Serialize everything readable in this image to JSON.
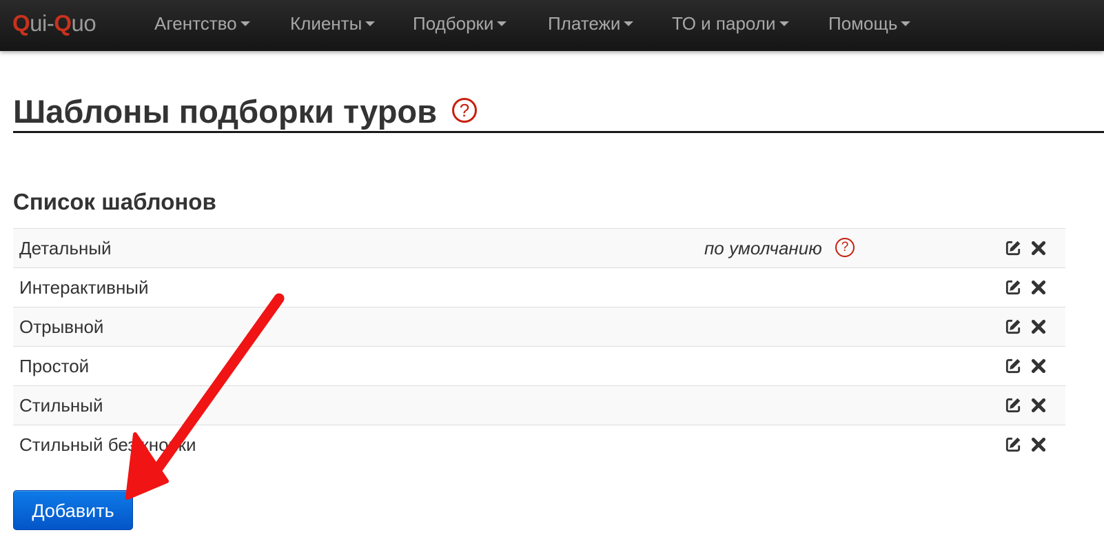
{
  "brand": {
    "q1": "Q",
    "mid": "ui-",
    "q2": "Q",
    "end": "uo"
  },
  "nav": {
    "items": [
      {
        "label": "Агентство"
      },
      {
        "label": "Клиенты"
      },
      {
        "label": "Подборки"
      },
      {
        "label": "Платежи"
      },
      {
        "label": "ТО и пароли"
      },
      {
        "label": "Помощь"
      }
    ]
  },
  "header": {
    "title": "Шаблоны подборки туров",
    "help_symbol": "?"
  },
  "templates": {
    "section_title": "Список шаблонов",
    "default_label": "по умолчанию",
    "help_symbol": "?",
    "rows": [
      {
        "name": "Детальный",
        "is_default": true
      },
      {
        "name": "Интерактивный",
        "is_default": false
      },
      {
        "name": "Отрывной",
        "is_default": false
      },
      {
        "name": "Простой",
        "is_default": false
      },
      {
        "name": "Стильный",
        "is_default": false
      },
      {
        "name": "Стильный без кнопки",
        "is_default": false
      }
    ],
    "row_actions": {
      "edit_icon": "edit-icon",
      "delete_icon": "delete-icon"
    }
  },
  "actions": {
    "add_label": "Добавить"
  },
  "colors": {
    "brand_accent": "#c8321e",
    "help_red": "#c81e0a",
    "button_blue": "#0a6ad8",
    "arrow_red": "#f01414",
    "navbar_bg": "#1c1c1c"
  }
}
